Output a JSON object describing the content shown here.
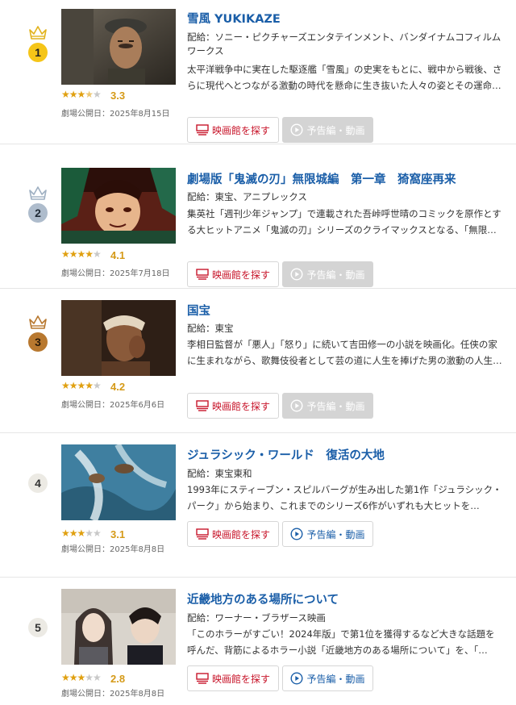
{
  "colors": {
    "title": "#1a5ea8",
    "theater_button": "#c8162b",
    "star": "#e0a010",
    "rating": "#d59a18"
  },
  "buttons": {
    "theater_label": "映画館を探す",
    "trailer_label": "予告編・動画"
  },
  "movies": [
    {
      "rank": "1",
      "title": "雪風 YUKIKAZE",
      "distributor": "配給：ソニー・ピクチャーズエンタテインメント、バンダイナムコフィルムワークス",
      "description": "太平洋戦争中に実在した駆逐艦「雪風」の史実をもとに、戦中から戦後、さらに現代へとつながる激動の時代を懸命に生き抜いた人々の姿とその運命…",
      "rating": "3.3",
      "release_date": "劇場公開日：2025年8月15日",
      "trailer_available": false
    },
    {
      "rank": "2",
      "title": "劇場版「鬼滅の刃」無限城編　第一章　猗窩座再来",
      "distributor": "配給：東宝、アニプレックス",
      "description": "集英社「週刊少年ジャンプ」で連載された吾峠呼世晴のコミックを原作とする大ヒットアニメ「鬼滅の刃」シリーズのクライマックスとなる、「無限…",
      "rating": "4.1",
      "release_date": "劇場公開日：2025年7月18日",
      "trailer_available": false
    },
    {
      "rank": "3",
      "title": "国宝",
      "distributor": "配給：東宝",
      "description": "李相日監督が「悪人」「怒り」に続いて吉田修一の小説を映画化。任侠の家に生まれながら、歌舞伎役者として芸の道に人生を捧げた男の激動の人生…",
      "rating": "4.2",
      "release_date": "劇場公開日：2025年6月6日",
      "trailer_available": false
    },
    {
      "rank": "4",
      "title": "ジュラシック・ワールド　復活の大地",
      "distributor": "配給：東宝東和",
      "description": "1993年にスティーブン・スピルバーグが生み出した第1作「ジュラシック・パーク」から始まり、これまでのシリーズ6作がいずれも大ヒットを…",
      "rating": "3.1",
      "release_date": "劇場公開日：2025年8月8日",
      "trailer_available": true
    },
    {
      "rank": "5",
      "title": "近畿地方のある場所について",
      "distributor": "配給：ワーナー・ブラザース映画",
      "description": "「このホラーがすごい！2024年版」で第1位を獲得するなど大きな話題を呼んだ、背筋によるホラー小説「近畿地方のある場所について」を、「…",
      "rating": "2.8",
      "release_date": "劇場公開日：2025年8月8日",
      "trailer_available": true
    }
  ]
}
